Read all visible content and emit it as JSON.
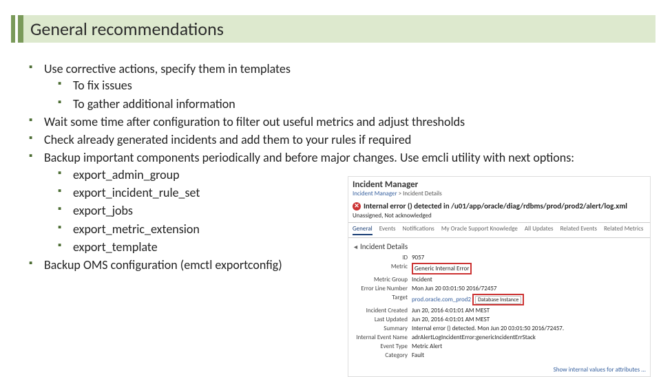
{
  "title": "General recommendations",
  "bullets": {
    "b1": "Use corrective actions, specify them in templates",
    "b1a": "To fix issues",
    "b1b": "To gather additional information",
    "b2": "Wait some time after configuration to filter out useful metrics and adjust thresholds",
    "b3": "Check already generated incidents and add them to your rules if required",
    "b4": "Backup important components periodically and before major changes. Use emcli utility with next options:",
    "b4a": "export_admin_group",
    "b4b": "export_incident_rule_set",
    "b4c": "export_jobs",
    "b4d": "export_metric_extension",
    "b4e": "export_template",
    "b5": "Backup OMS configuration (emctl exportconfig)"
  },
  "inset": {
    "header": "Incident Manager",
    "crumb_a": "Incident Manager",
    "crumb_b": "Incident Details",
    "err_pre": "Internal error () detected in ",
    "err_path": "/u01/app/oracle/diag/rdbms/prod/prod2/alert/log.xml",
    "status": "Unassigned, Not acknowledged",
    "tabs": {
      "t1": "General",
      "t2": "Events",
      "t3": "Notifications",
      "t4": "My Oracle Support Knowledge",
      "t5": "All Updates",
      "t6": "Related Events",
      "t7": "Related Metrics"
    },
    "panel_title": "Incident Details",
    "kv": {
      "id_k": "ID",
      "id_v": "9057",
      "metric_k": "Metric",
      "metric_v": "Generic Internal Error",
      "mg_k": "Metric Group",
      "mg_v": "Incident",
      "el_k": "Error Line Number",
      "el_v": "Mon Jun 20 03:01:50 2016/72457",
      "target_k": "Target",
      "target_v": "prod.oracle.com_prod2",
      "target_tag": "Database Instance",
      "cr_k": "Incident Created",
      "cr_v": "Jun 20, 2016 4:01:01 AM MEST",
      "lu_k": "Last Updated",
      "lu_v": "Jun 20, 2016 4:01:01 AM MEST",
      "sum_k": "Summary",
      "sum_v": "Internal error () detected. Mon Jun 20 03:01:50 2016/72457.",
      "ie_k": "Internal Event Name",
      "ie_v": "adrAlertLogIncidentError:genericIncidentErrStack",
      "et_k": "Event Type",
      "et_v": "Metric Alert",
      "cat_k": "Category",
      "cat_v": "Fault"
    },
    "footer": "Show internal values for attributes ..."
  }
}
